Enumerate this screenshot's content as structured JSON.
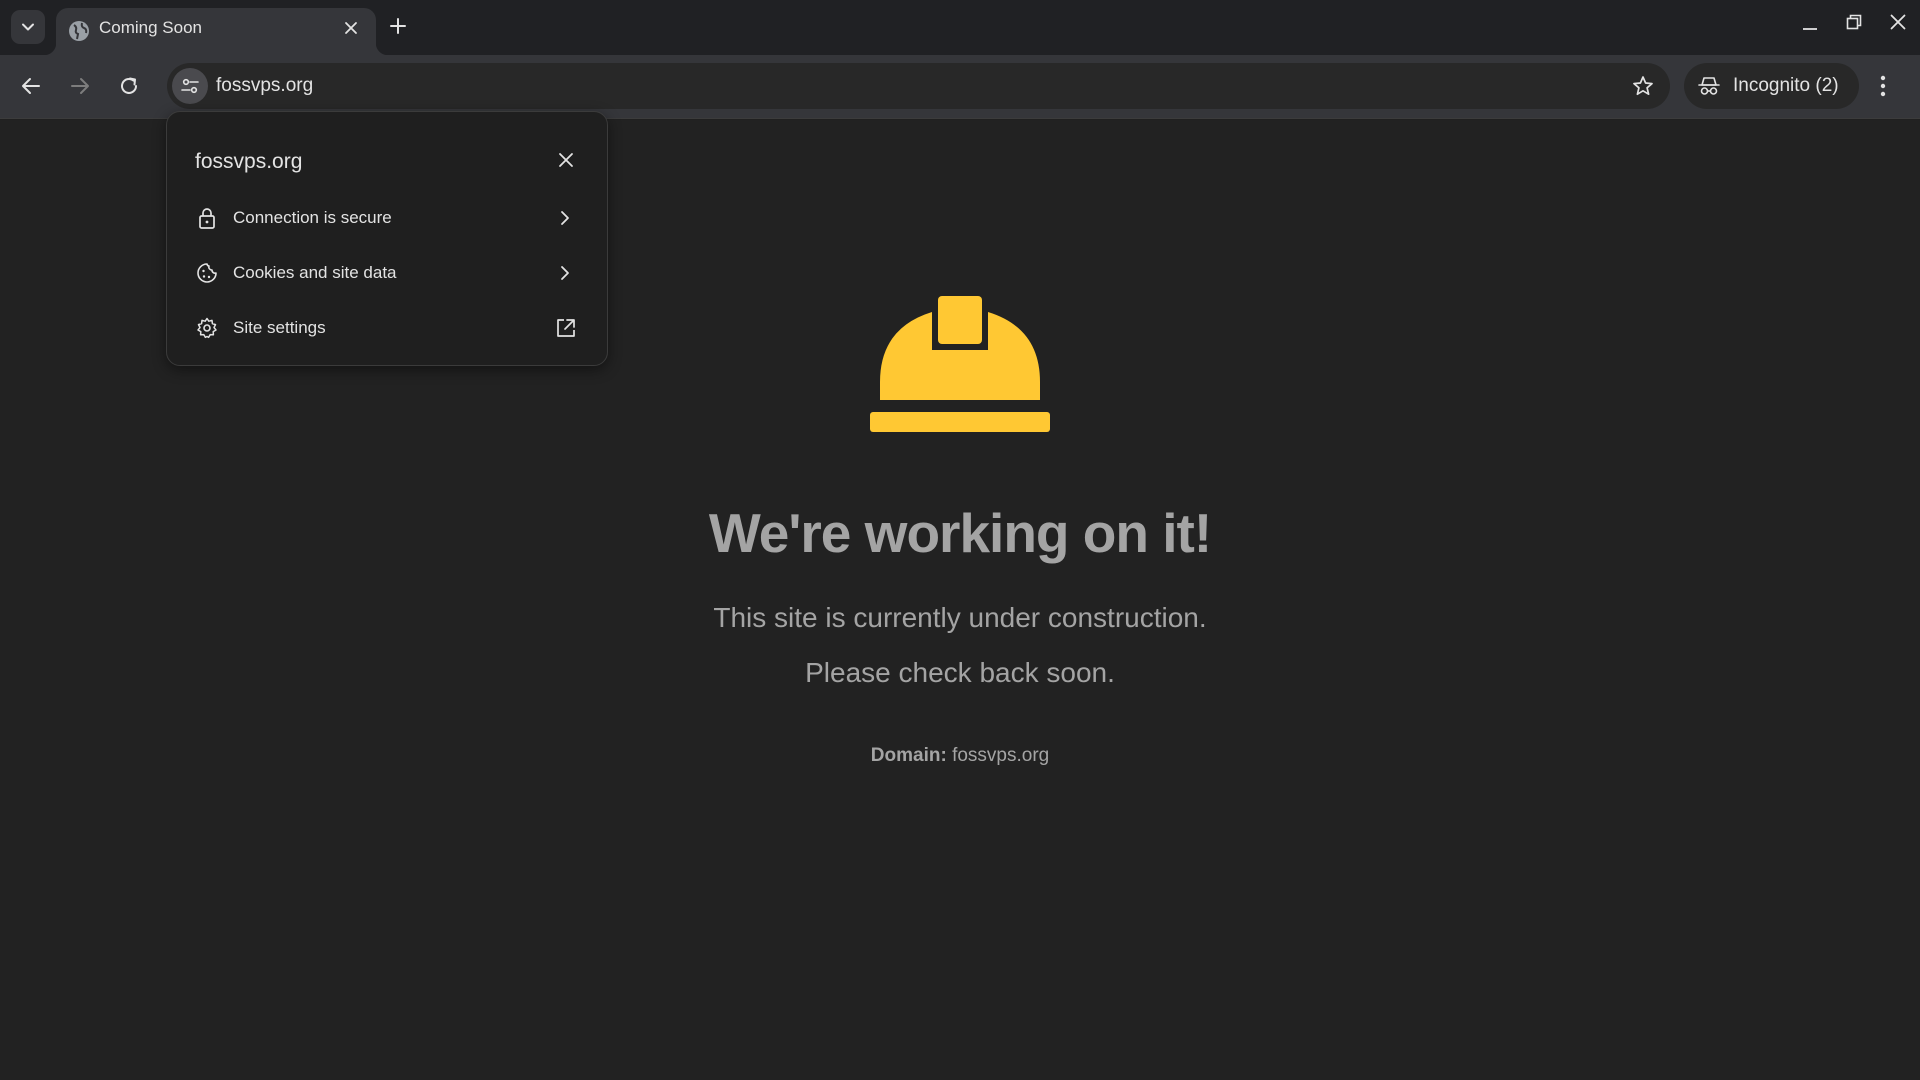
{
  "browser": {
    "tab": {
      "title": "Coming Soon"
    },
    "address_bar": {
      "url": "fossvps.org"
    },
    "incognito": {
      "label": "Incognito (2)"
    }
  },
  "site_info_popup": {
    "title": "fossvps.org",
    "items": [
      {
        "label": "Connection is secure",
        "icon": "lock-icon",
        "trailing": "chevron-right-icon"
      },
      {
        "label": "Cookies and site data",
        "icon": "cookie-icon",
        "trailing": "chevron-right-icon"
      },
      {
        "label": "Site settings",
        "icon": "gear-icon",
        "trailing": "external-link-icon"
      }
    ]
  },
  "page": {
    "headline": "We're working on it!",
    "line1": "This site is currently under construction.",
    "line2": "Please check back soon.",
    "domain_label": "Domain:",
    "domain_value": "fossvps.org",
    "hardhat_color": "#ffc833"
  }
}
